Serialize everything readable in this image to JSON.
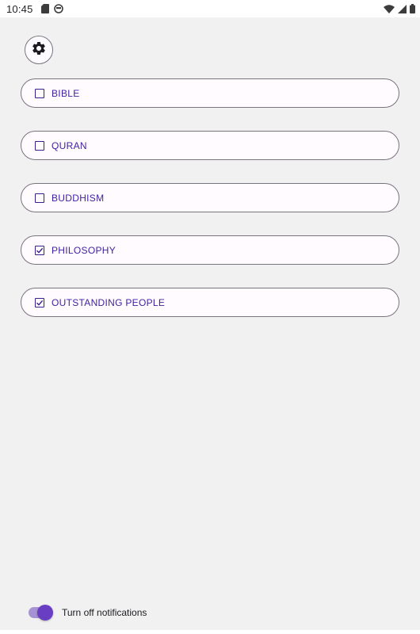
{
  "status_bar": {
    "time": "10:45",
    "left_icons": [
      "sd-card-icon",
      "app-notification-icon"
    ],
    "right_icons": [
      "wifi-icon",
      "signal-icon",
      "battery-icon"
    ]
  },
  "settings": {
    "icon": "gear-icon"
  },
  "options": [
    {
      "label": "BIBLE",
      "checked": false
    },
    {
      "label": "QURAN",
      "checked": false
    },
    {
      "label": "BUDDHISM",
      "checked": false
    },
    {
      "label": "PHILOSOPHY",
      "checked": true
    },
    {
      "label": "OUTSTANDING PEOPLE",
      "checked": true
    }
  ],
  "notifications": {
    "label": "Turn off notifications",
    "enabled": true
  },
  "colors": {
    "accent": "#6a3ec2",
    "label_text": "#3f1ea1",
    "outline": "#79747e"
  }
}
